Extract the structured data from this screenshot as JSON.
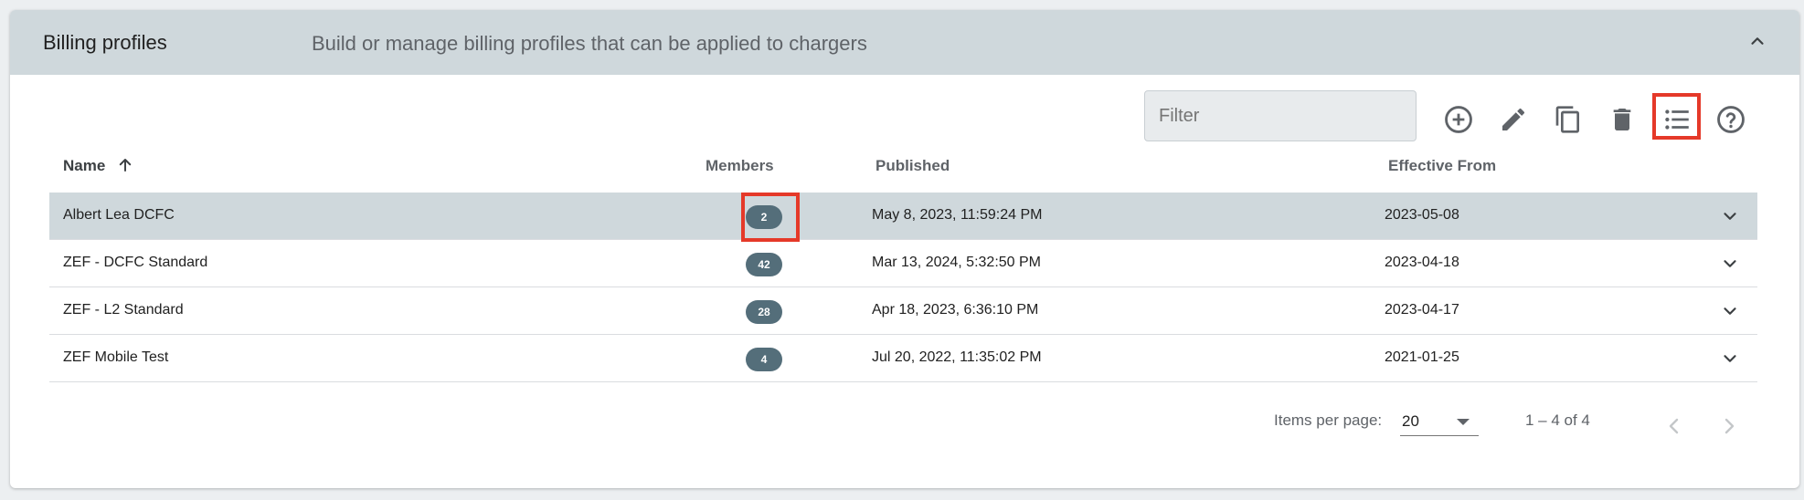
{
  "panel": {
    "title": "Billing profiles",
    "description": "Build or manage billing profiles that can be applied to chargers"
  },
  "toolbar": {
    "filter_placeholder": "Filter",
    "filter_value": "",
    "buttons": [
      {
        "icon": "add-circle-icon"
      },
      {
        "icon": "edit-icon"
      },
      {
        "icon": "copy-icon"
      },
      {
        "icon": "delete-icon"
      },
      {
        "icon": "list-icon"
      },
      {
        "icon": "help-icon"
      }
    ]
  },
  "table": {
    "columns": {
      "name": "Name",
      "members": "Members",
      "published": "Published",
      "effective_from": "Effective From"
    },
    "sort_icon": "arrow-up-icon",
    "rows": [
      {
        "name": "Albert Lea DCFC",
        "members": "2",
        "published": "May 8, 2023, 11:59:24 PM",
        "effective_from": "2023-05-08",
        "selected": true
      },
      {
        "name": "ZEF - DCFC Standard",
        "members": "42",
        "published": "Mar 13, 2024, 5:32:50 PM",
        "effective_from": "2023-04-18",
        "selected": false
      },
      {
        "name": "ZEF - L2 Standard",
        "members": "28",
        "published": "Apr 18, 2023, 6:36:10 PM",
        "effective_from": "2023-04-17",
        "selected": false
      },
      {
        "name": "ZEF Mobile Test",
        "members": "4",
        "published": "Jul 20, 2022, 11:35:02 PM",
        "effective_from": "2021-01-25",
        "selected": false
      }
    ]
  },
  "paginator": {
    "items_per_page_label": "Items per page:",
    "page_size": "20",
    "range_label": "1 – 4 of 4"
  },
  "colors": {
    "header_bg": "#cfd8dc",
    "selected_row_bg": "#cfd8dc",
    "badge_bg": "#546e7a",
    "highlight": "#e53929",
    "icon": "#5f6368"
  }
}
